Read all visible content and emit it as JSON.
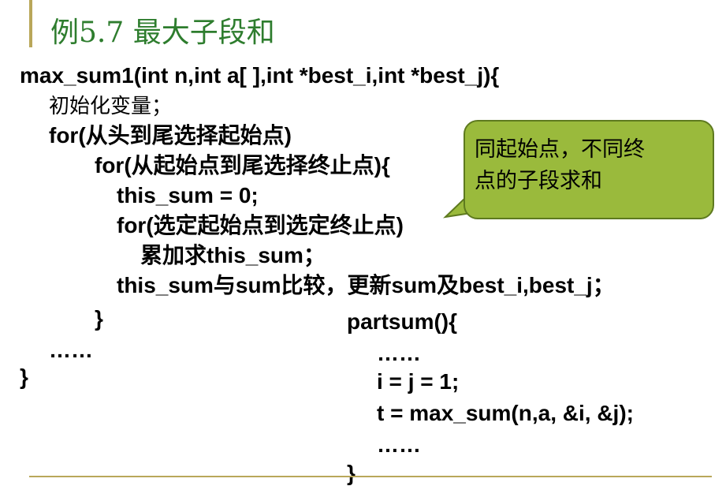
{
  "slide": {
    "title": "例5.7  最大子段和"
  },
  "left_code": [
    {
      "text": "max_sum1(int n,int a[ ],int *best_i,int *best_j){"
    },
    {
      "text": "初始化变量；"
    },
    {
      "text": "for(从头到尾选择起始点)"
    },
    {
      "text": "for(从起始点到尾选择终止点){"
    },
    {
      "text": "this_sum = 0;"
    },
    {
      "text": "for(选定起始点到选定终止点)"
    },
    {
      "text": "累加求this_sum；"
    },
    {
      "text": "this_sum与sum比较，更新sum及best_i,best_j；"
    },
    {
      "text": "}"
    },
    {
      "text": "……"
    },
    {
      "text": "}"
    }
  ],
  "right_code": [
    {
      "text": "partsum(){"
    },
    {
      "text": "……"
    },
    {
      "text": "i = j = 1;"
    },
    {
      "text": "t = max_sum(n,a, &i, &j);"
    },
    {
      "text": "……"
    },
    {
      "text": "}"
    }
  ],
  "callout": {
    "line1": "同起始点，不同终",
    "line2": "点的子段求和"
  },
  "colors": {
    "title": "#2e7d2e",
    "accent": "#b9a75a",
    "callout_fill": "#9aba3c",
    "callout_border": "#5e7a1f"
  }
}
